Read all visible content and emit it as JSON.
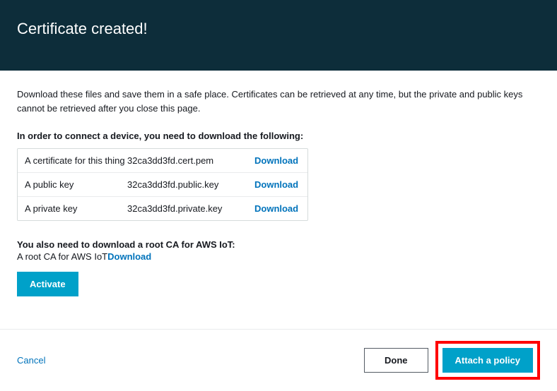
{
  "header": {
    "title": "Certificate created!"
  },
  "intro": "Download these files and save them in a safe place. Certificates can be retrieved at any time, but the private and public keys cannot be retrieved after you close this page.",
  "files_heading": "In order to connect a device, you need to download the following:",
  "files": [
    {
      "label": "A certificate for this thing",
      "name": "32ca3dd3fd.cert.pem",
      "action": "Download"
    },
    {
      "label": "A public key",
      "name": "32ca3dd3fd.public.key",
      "action": "Download"
    },
    {
      "label": "A private key",
      "name": "32ca3dd3fd.private.key",
      "action": "Download"
    }
  ],
  "rootca": {
    "heading": "You also need to download a root CA for AWS IoT:",
    "text": "A root CA for AWS IoT",
    "link": "Download"
  },
  "buttons": {
    "activate": "Activate",
    "cancel": "Cancel",
    "done": "Done",
    "attach": "Attach a policy"
  }
}
